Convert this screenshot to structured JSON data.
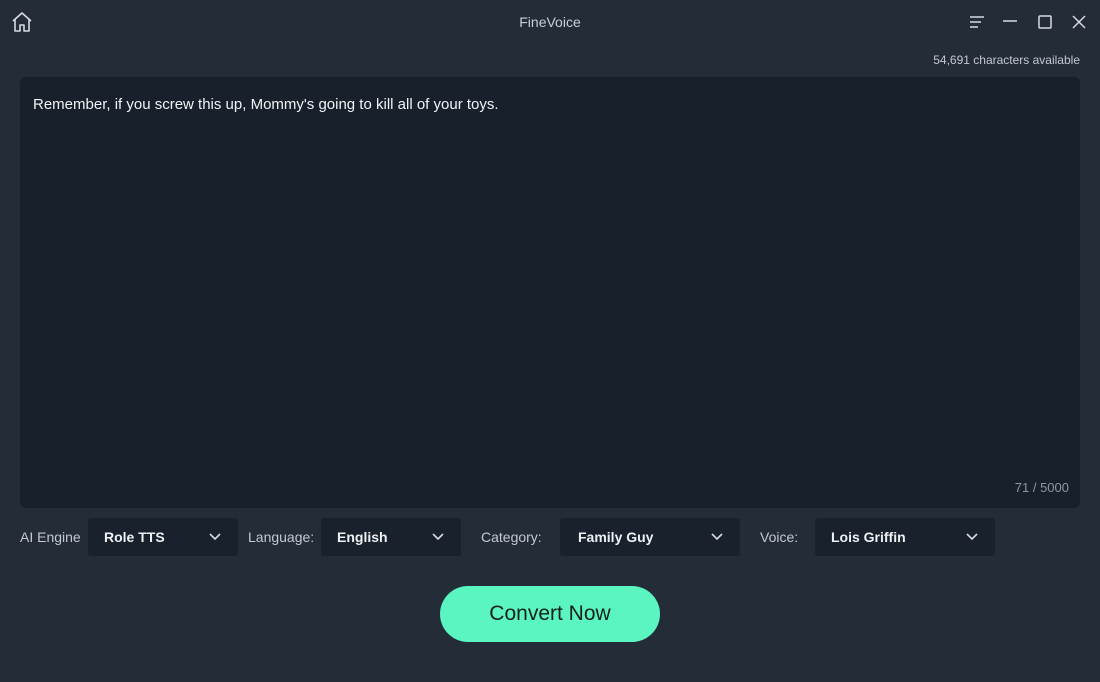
{
  "app": {
    "title": "FineVoice"
  },
  "icons": {
    "home": "home-icon",
    "menu": "menu-icon",
    "minimize": "minimize-icon",
    "maximize": "maximize-icon",
    "close": "close-icon",
    "dropdown": "chevron-down-icon"
  },
  "editor": {
    "characters_available": "54,691 characters available",
    "text": "Remember, if you screw this up, Mommy's going to kill all of your toys.",
    "char_count": "71 / 5000"
  },
  "options": {
    "ai_engine": {
      "label": "AI Engine",
      "value": "Role TTS"
    },
    "language": {
      "label": "Language:",
      "value": "English"
    },
    "category": {
      "label": "Category:",
      "value": "Family Guy"
    },
    "voice": {
      "label": "Voice:",
      "value": "Lois Griffin"
    }
  },
  "actions": {
    "convert_label": "Convert Now"
  },
  "colors": {
    "background": "#232c37",
    "editor_bg": "#18202b",
    "select_bg": "#19212c",
    "accent": "#5af5c1"
  }
}
